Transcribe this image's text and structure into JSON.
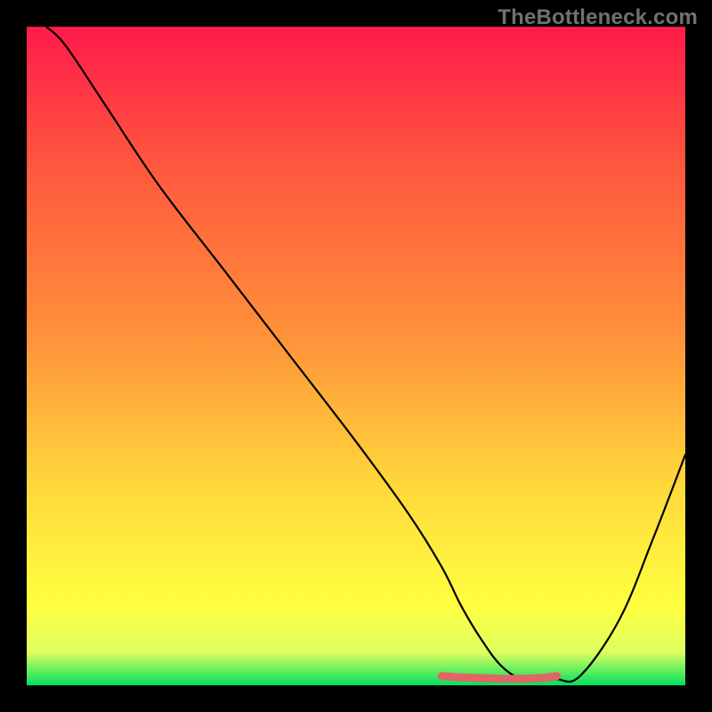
{
  "watermark": {
    "text": "TheBottleneck.com"
  },
  "chart_data": {
    "type": "line",
    "title": "",
    "xlabel": "",
    "ylabel": "",
    "xlim": [
      0,
      100
    ],
    "ylim": [
      0,
      100
    ],
    "grid": false,
    "legend": false,
    "background_gradient": {
      "top": "#ff1a4b",
      "upper_mid": "#ff8c3a",
      "mid": "#ffd93a",
      "lower_mid": "#ffff40",
      "near_bottom": "#dcff60",
      "bottom": "#00e060"
    },
    "series": [
      {
        "name": "main-curve",
        "color": "#000000",
        "x": [
          3,
          6,
          12,
          20,
          30,
          40,
          50,
          58,
          63,
          66,
          69,
          72,
          75,
          78,
          80.5,
          84,
          90,
          95,
          100
        ],
        "values": [
          100,
          97,
          88,
          76,
          63,
          50,
          37,
          26,
          18,
          12,
          7,
          3,
          1,
          0.9,
          0.9,
          1.4,
          10,
          22,
          35
        ]
      },
      {
        "name": "highlight-band",
        "color": "#e06666",
        "x": [
          63,
          66,
          69,
          72,
          75,
          78,
          80.5
        ],
        "values": [
          1.4,
          1.2,
          1.1,
          1.0,
          1.0,
          1.1,
          1.4
        ]
      }
    ]
  }
}
